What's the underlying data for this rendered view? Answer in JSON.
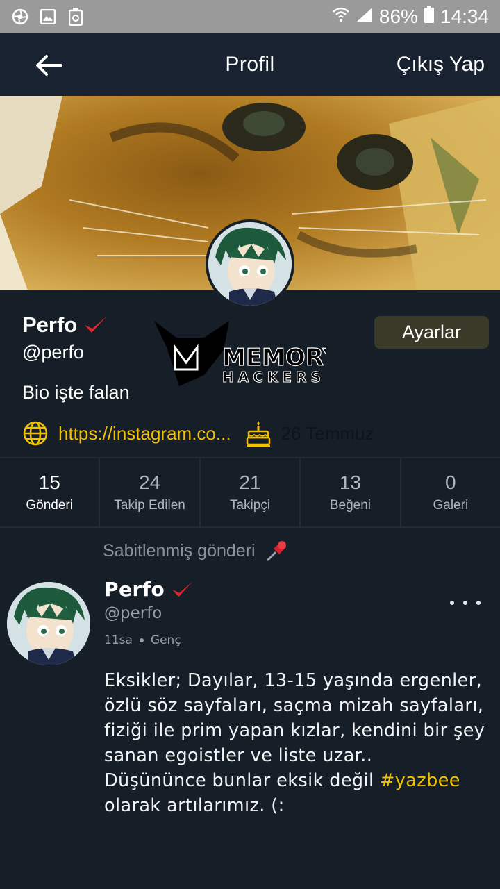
{
  "status_bar": {
    "battery": "86%",
    "time": "14:34"
  },
  "app_bar": {
    "title": "Profil",
    "logout_label": "Çıkış Yap"
  },
  "profile": {
    "name": "Perfo",
    "handle": "@perfo",
    "bio": "Bio işte falan",
    "link": "https://instagram.co...",
    "birthday": "26 Temmuz",
    "settings_label": "Ayarlar"
  },
  "watermark": {
    "line1": "MEMORY",
    "line2": "HACKERS"
  },
  "stats": [
    {
      "value": "15",
      "label": "Gönderi"
    },
    {
      "value": "24",
      "label": "Takip Edilen"
    },
    {
      "value": "21",
      "label": "Takipçi"
    },
    {
      "value": "13",
      "label": "Beğeni"
    },
    {
      "value": "0",
      "label": "Galeri"
    }
  ],
  "post": {
    "pinned_label": "Sabitlenmiş gönderi",
    "author": "Perfo",
    "handle": "@perfo",
    "time": "11sa",
    "category": "Genç",
    "body_main": "Eksikler; Dayılar, 13-15 yaşında ergenler, özlü söz sayfaları, saçma mizah sayfaları, fiziği ile prim yapan kızlar, kendini bir şey sanan egoistler ve liste uzar..",
    "body_second": "Düşününce bunlar eksik değil ",
    "hashtag": "#yazbee",
    "body_end": " olarak artılarımız. (:"
  },
  "colors": {
    "accent": "#f2c200",
    "background": "#161e28",
    "verified": "#e0262b"
  }
}
